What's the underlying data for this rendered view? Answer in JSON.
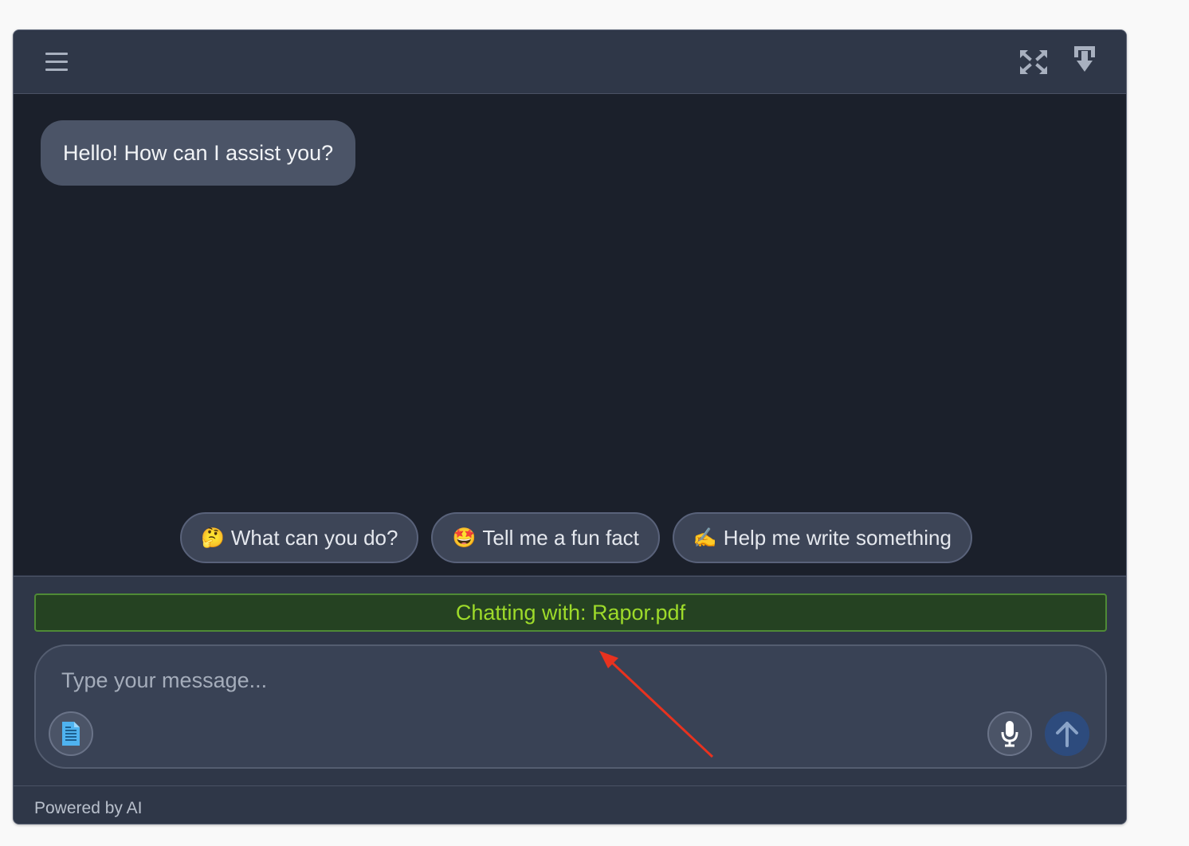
{
  "header": {
    "menu_icon": "hamburger-menu-icon",
    "expand_icon": "expand-arrows-icon",
    "download_icon": "download-arrow-icon"
  },
  "messages": [
    {
      "role": "assistant",
      "text": "Hello! How can I assist you?"
    }
  ],
  "suggestions": [
    {
      "emoji": "🤔",
      "label": "What can you do?"
    },
    {
      "emoji": "🤩",
      "label": "Tell me a fun fact"
    },
    {
      "emoji": "✍️",
      "label": "Help me write something"
    }
  ],
  "context_banner": "Chatting with: Rapor.pdf",
  "input": {
    "placeholder": "Type your message...",
    "value": "",
    "attach_icon": "document-icon",
    "mic_icon": "microphone-icon",
    "send_icon": "arrow-up-icon"
  },
  "footer": {
    "powered_by": "Powered by AI"
  },
  "colors": {
    "header_bg": "#2f3748",
    "messages_bg": "#1b202b",
    "bubble_bg": "#4b5467",
    "banner_bg": "#254222",
    "banner_text": "#9edb2a",
    "send_button_bg": "#2d4b7d",
    "annotation_arrow": "#e8321f"
  }
}
